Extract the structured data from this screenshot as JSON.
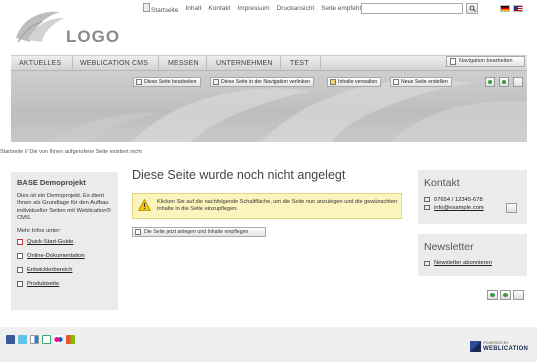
{
  "meta_nav": {
    "items": [
      "Startseite",
      "Inhalt",
      "Kontakt",
      "Impressum",
      "Druckansicht",
      "Seite empfehlen"
    ],
    "search_value": ""
  },
  "logo": {
    "text": "LOGO"
  },
  "main_nav": {
    "items": [
      "AKTUELLES",
      "WEBLICATION CMS",
      "MESSEN",
      "UNTERNEHMEN",
      "TEST"
    ],
    "edit_label": "Navigation bearbeiten"
  },
  "edit_toolbar": {
    "buttons": [
      "Diese Seite bearbeiten",
      "Diese Seite in der Navigation verlinken",
      "Inhalte verwalten",
      "Neue Seite erstellen"
    ]
  },
  "breadcrumb": "Startseite // Die von Ihnen aufgerufene Seite existiert nicht",
  "sidebar": {
    "title": "BASE Demoprojekt",
    "text": "Dies ist ein Demoprojekt. Es dient Ihnen als Grundlage für den Aufbau individueller Seiten mit Weblication® CMS.",
    "more": "Mehr Infos unter:",
    "links": [
      "Quick-Start-Guide",
      "Online-Dokumentation",
      "Entwicklerbereich",
      "Produktseite"
    ]
  },
  "main": {
    "title": "Diese Seite wurde noch nicht angelegt",
    "notice": "Klicken Sie auf die nachfolgende Schaltfläche, um die Seite nun anzulegen und die gewünschten Inhalte in die Seite einzupflegen.",
    "create_button": "Die Seite jetzt anlegen und Inhalte einpflegen"
  },
  "contact": {
    "title": "Kontakt",
    "phone": "07654 / 12345-678",
    "email": "info@example.com"
  },
  "newsletter": {
    "title": "Newsletter",
    "link": "Newsletter abonnieren"
  },
  "footer": {
    "powered_small": "POWERED BY",
    "powered_brand": "WEBLICATION",
    "social_icons": [
      "facebook-icon",
      "twitter-icon",
      "delicious-icon",
      "google-icon",
      "flickr-icon",
      "windows-live-icon"
    ]
  },
  "colors": {
    "notice_bg": "#fbf4bd",
    "box_bg": "#ebebeb",
    "footer_bg": "#efefef",
    "brand_blue": "#1b2a55"
  }
}
